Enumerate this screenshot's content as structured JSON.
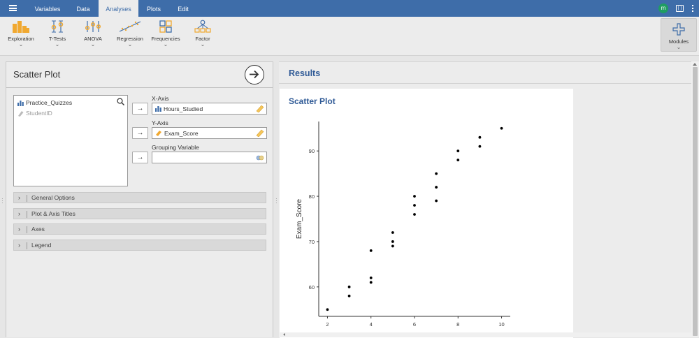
{
  "menu": {
    "tabs": [
      {
        "label": "Variables",
        "active": false
      },
      {
        "label": "Data",
        "active": false
      },
      {
        "label": "Analyses",
        "active": true
      },
      {
        "label": "Plots",
        "active": false
      },
      {
        "label": "Edit",
        "active": false
      }
    ],
    "user_initial": "m"
  },
  "ribbon": {
    "buttons": [
      {
        "label": "Exploration",
        "icon": "exploration-icon"
      },
      {
        "label": "T-Tests",
        "icon": "t-tests-icon"
      },
      {
        "label": "ANOVA",
        "icon": "anova-icon"
      },
      {
        "label": "Regression",
        "icon": "regression-icon"
      },
      {
        "label": "Frequencies",
        "icon": "frequencies-icon"
      },
      {
        "label": "Factor",
        "icon": "factor-icon"
      }
    ],
    "modules_label": "Modules",
    "chevron": "⌄"
  },
  "options_panel": {
    "title": "Scatter Plot",
    "variables": [
      {
        "name": "Practice_Quizzes",
        "type": "nominal",
        "enabled": true
      },
      {
        "name": "StudentID",
        "type": "id",
        "enabled": false
      }
    ],
    "x_axis": {
      "label": "X-Axis",
      "value": "Hours_Studied"
    },
    "y_axis": {
      "label": "Y-Axis",
      "value": "Exam_Score"
    },
    "grouping": {
      "label": "Grouping Variable",
      "value": ""
    },
    "arrow": "→",
    "sections": [
      {
        "label": "General Options"
      },
      {
        "label": "Plot & Axis Titles"
      },
      {
        "label": "Axes"
      },
      {
        "label": "Legend"
      }
    ],
    "section_chevron": "›"
  },
  "results": {
    "title": "Results",
    "plot_title": "Scatter Plot"
  },
  "chart_data": {
    "type": "scatter",
    "title": "",
    "xlabel": "",
    "ylabel": "Exam_Score",
    "xticks": [
      2,
      4,
      6,
      8,
      10
    ],
    "yticks": [
      60,
      70,
      80,
      90
    ],
    "xlim": [
      1.6,
      10.4
    ],
    "ylim": [
      53.5,
      96.5
    ],
    "grid": false,
    "points": [
      {
        "x": 2,
        "y": 55
      },
      {
        "x": 3,
        "y": 58
      },
      {
        "x": 3,
        "y": 60
      },
      {
        "x": 4,
        "y": 61
      },
      {
        "x": 4,
        "y": 62
      },
      {
        "x": 4,
        "y": 68
      },
      {
        "x": 5,
        "y": 69
      },
      {
        "x": 5,
        "y": 70
      },
      {
        "x": 5,
        "y": 72
      },
      {
        "x": 6,
        "y": 76
      },
      {
        "x": 6,
        "y": 78
      },
      {
        "x": 6,
        "y": 80
      },
      {
        "x": 7,
        "y": 79
      },
      {
        "x": 7,
        "y": 82
      },
      {
        "x": 7,
        "y": 85
      },
      {
        "x": 8,
        "y": 88
      },
      {
        "x": 8,
        "y": 90
      },
      {
        "x": 9,
        "y": 91
      },
      {
        "x": 9,
        "y": 93
      },
      {
        "x": 10,
        "y": 95
      }
    ]
  }
}
